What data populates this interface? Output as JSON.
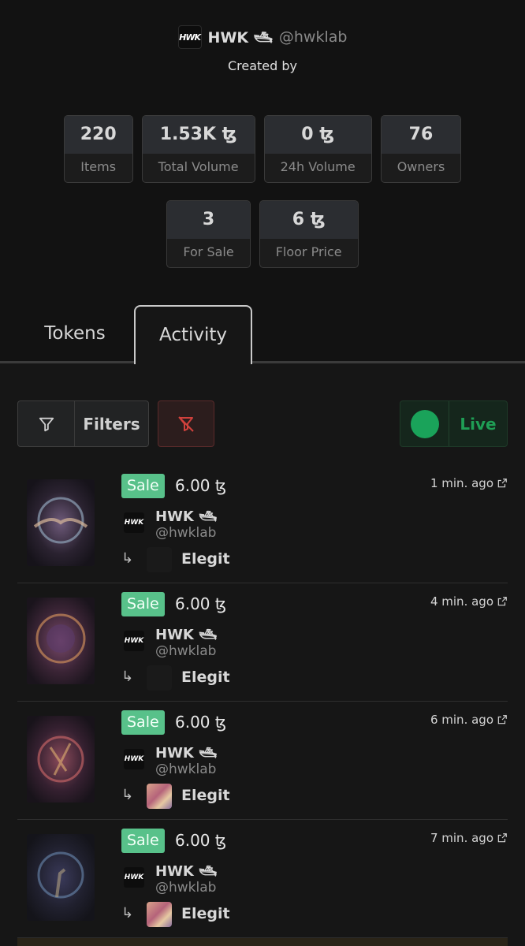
{
  "creator": {
    "logo_text": "HWK",
    "name": "HWK 🛥",
    "handle": "@hwklab",
    "created_by_label": "Created by"
  },
  "stats_row1": [
    {
      "value": "220",
      "label": "Items"
    },
    {
      "value": "1.53K ꜩ",
      "label": "Total Volume"
    },
    {
      "value": "0 ꜩ",
      "label": "24h Volume"
    },
    {
      "value": "76",
      "label": "Owners"
    }
  ],
  "stats_row2": [
    {
      "value": "3",
      "label": "For Sale"
    },
    {
      "value": "6 ꜩ",
      "label": "Floor Price"
    }
  ],
  "tabs": {
    "tokens": "Tokens",
    "activity": "Activity"
  },
  "toolbar": {
    "filters_label": "Filters",
    "live_label": "Live"
  },
  "activity": [
    {
      "type": "Sale",
      "price": "6.00 ꜩ",
      "time": "1 min. ago",
      "seller_name": "HWK 🛥",
      "seller_handle": "@hwklab",
      "buyer": "Elegit"
    },
    {
      "type": "Sale",
      "price": "6.00 ꜩ",
      "time": "4 min. ago",
      "seller_name": "HWK 🛥",
      "seller_handle": "@hwklab",
      "buyer": "Elegit"
    },
    {
      "type": "Sale",
      "price": "6.00 ꜩ",
      "time": "6 min. ago",
      "seller_name": "HWK 🛥",
      "seller_handle": "@hwklab",
      "buyer": "Elegit"
    },
    {
      "type": "Sale",
      "price": "6.00 ꜩ",
      "time": "7 min. ago",
      "seller_name": "HWK 🛥",
      "seller_handle": "@hwklab",
      "buyer": "Elegit"
    }
  ],
  "colors": {
    "sale_badge": "#58c18a",
    "live": "#1aa35a",
    "clear_filter": "#d0413c"
  }
}
